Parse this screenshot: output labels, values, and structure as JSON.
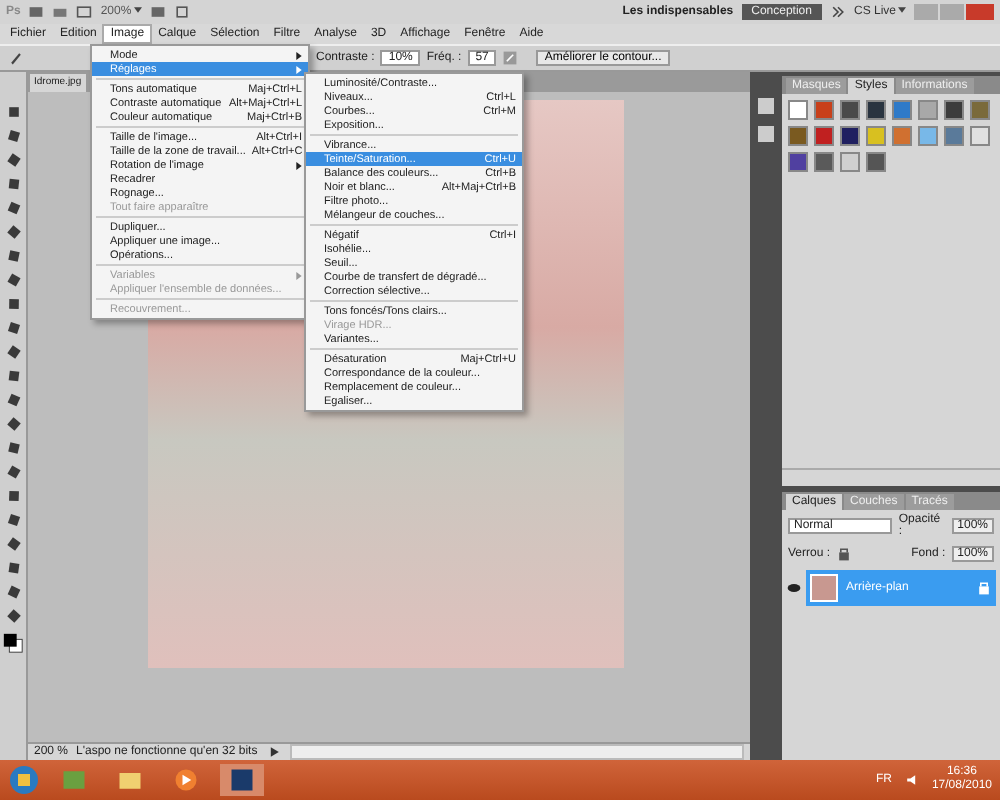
{
  "app_bar": {
    "logo": "Ps",
    "zoom": "200%",
    "workspace": "Les indispensables",
    "workspace_button": "Conception",
    "cs_live": "CS Live"
  },
  "menu_bar": [
    {
      "label": "Fichier",
      "selected": false
    },
    {
      "label": "Edition",
      "selected": false
    },
    {
      "label": "Image",
      "selected": true
    },
    {
      "label": "Calque",
      "selected": false
    },
    {
      "label": "Sélection",
      "selected": false
    },
    {
      "label": "Filtre",
      "selected": false
    },
    {
      "label": "Analyse",
      "selected": false
    },
    {
      "label": "3D",
      "selected": false
    },
    {
      "label": "Affichage",
      "selected": false
    },
    {
      "label": "Fenêtre",
      "selected": false
    },
    {
      "label": "Aide",
      "selected": false
    }
  ],
  "options_bar": {
    "contrast_label": "Contraste :",
    "contrast_value": "10%",
    "freq_label": "Fréq. :",
    "freq_value": "57",
    "refine_button": "Améliorer le contour..."
  },
  "document": {
    "tab": "Idrome.jpg",
    "zoom": "200 %",
    "status": "L'aspo ne fonctionne qu'en 32 bits"
  },
  "image_menu": [
    {
      "kind": "item",
      "label": "Mode",
      "submenu": true,
      "selected": false,
      "disabled": false
    },
    {
      "kind": "item",
      "label": "Réglages",
      "submenu": true,
      "selected": true,
      "disabled": false
    },
    {
      "kind": "separator"
    },
    {
      "kind": "item",
      "label": "Tons automatique",
      "shortcut": "Maj+Ctrl+L",
      "selected": false,
      "disabled": false
    },
    {
      "kind": "item",
      "label": "Contraste automatique",
      "shortcut": "Alt+Maj+Ctrl+L",
      "selected": false,
      "disabled": false
    },
    {
      "kind": "item",
      "label": "Couleur automatique",
      "shortcut": "Maj+Ctrl+B",
      "selected": false,
      "disabled": false
    },
    {
      "kind": "separator"
    },
    {
      "kind": "item",
      "label": "Taille de l'image...",
      "shortcut": "Alt+Ctrl+I",
      "selected": false,
      "disabled": false
    },
    {
      "kind": "item",
      "label": "Taille de la zone de travail...",
      "shortcut": "Alt+Ctrl+C",
      "selected": false,
      "disabled": false
    },
    {
      "kind": "item",
      "label": "Rotation de l'image",
      "submenu": true,
      "selected": false,
      "disabled": false
    },
    {
      "kind": "item",
      "label": "Recadrer",
      "selected": false,
      "disabled": false
    },
    {
      "kind": "item",
      "label": "Rognage...",
      "selected": false,
      "disabled": false
    },
    {
      "kind": "item",
      "label": "Tout faire apparaître",
      "selected": false,
      "disabled": true
    },
    {
      "kind": "separator"
    },
    {
      "kind": "item",
      "label": "Dupliquer...",
      "selected": false,
      "disabled": false
    },
    {
      "kind": "item",
      "label": "Appliquer une image...",
      "selected": false,
      "disabled": false
    },
    {
      "kind": "item",
      "label": "Opérations...",
      "selected": false,
      "disabled": false
    },
    {
      "kind": "separator"
    },
    {
      "kind": "item",
      "label": "Variables",
      "submenu": true,
      "selected": false,
      "disabled": true
    },
    {
      "kind": "item",
      "label": "Appliquer l'ensemble de données...",
      "selected": false,
      "disabled": true
    },
    {
      "kind": "separator"
    },
    {
      "kind": "item",
      "label": "Recouvrement...",
      "selected": false,
      "disabled": true
    }
  ],
  "adjust_menu": [
    {
      "kind": "item",
      "label": "Luminosité/Contraste...",
      "selected": false,
      "disabled": false
    },
    {
      "kind": "item",
      "label": "Niveaux...",
      "shortcut": "Ctrl+L",
      "selected": false,
      "disabled": false
    },
    {
      "kind": "item",
      "label": "Courbes...",
      "shortcut": "Ctrl+M",
      "selected": false,
      "disabled": false
    },
    {
      "kind": "item",
      "label": "Exposition...",
      "selected": false,
      "disabled": false
    },
    {
      "kind": "separator"
    },
    {
      "kind": "item",
      "label": "Vibrance...",
      "selected": false,
      "disabled": false
    },
    {
      "kind": "item",
      "label": "Teinte/Saturation...",
      "shortcut": "Ctrl+U",
      "selected": true,
      "disabled": false
    },
    {
      "kind": "item",
      "label": "Balance des couleurs...",
      "shortcut": "Ctrl+B",
      "selected": false,
      "disabled": false
    },
    {
      "kind": "item",
      "label": "Noir et blanc...",
      "shortcut": "Alt+Maj+Ctrl+B",
      "selected": false,
      "disabled": false
    },
    {
      "kind": "item",
      "label": "Filtre photo...",
      "selected": false,
      "disabled": false
    },
    {
      "kind": "item",
      "label": "Mélangeur de couches...",
      "selected": false,
      "disabled": false
    },
    {
      "kind": "separator"
    },
    {
      "kind": "item",
      "label": "Négatif",
      "shortcut": "Ctrl+I",
      "selected": false,
      "disabled": false
    },
    {
      "kind": "item",
      "label": "Isohélie...",
      "selected": false,
      "disabled": false
    },
    {
      "kind": "item",
      "label": "Seuil...",
      "selected": false,
      "disabled": false
    },
    {
      "kind": "item",
      "label": "Courbe de transfert de dégradé...",
      "selected": false,
      "disabled": false
    },
    {
      "kind": "item",
      "label": "Correction sélective...",
      "selected": false,
      "disabled": false
    },
    {
      "kind": "separator"
    },
    {
      "kind": "item",
      "label": "Tons foncés/Tons clairs...",
      "selected": false,
      "disabled": false
    },
    {
      "kind": "item",
      "label": "Virage HDR...",
      "selected": false,
      "disabled": true
    },
    {
      "kind": "item",
      "label": "Variantes...",
      "selected": false,
      "disabled": false
    },
    {
      "kind": "separator"
    },
    {
      "kind": "item",
      "label": "Désaturation",
      "shortcut": "Maj+Ctrl+U",
      "selected": false,
      "disabled": false
    },
    {
      "kind": "item",
      "label": "Correspondance de la couleur...",
      "selected": false,
      "disabled": false
    },
    {
      "kind": "item",
      "label": "Remplacement de couleur...",
      "selected": false,
      "disabled": false
    },
    {
      "kind": "item",
      "label": "Egaliser...",
      "selected": false,
      "disabled": false
    }
  ],
  "styles_panel": {
    "tabs": [
      {
        "label": "Masques",
        "selected": false
      },
      {
        "label": "Styles",
        "selected": true
      },
      {
        "label": "Informations",
        "selected": false
      }
    ],
    "swatches": [
      {
        "color": "#ffffff"
      },
      {
        "color": "#c8401a"
      },
      {
        "color": "#4a4a4a"
      },
      {
        "color": "#2a3440"
      },
      {
        "color": "#2f7ac8"
      },
      {
        "color": "#a8a8a8"
      },
      {
        "color": "#3c3c3c"
      },
      {
        "color": "#7a6a3a"
      },
      {
        "color": "#7a5a20"
      },
      {
        "color": "#c02020"
      },
      {
        "color": "#202060"
      },
      {
        "color": "#d8c020"
      },
      {
        "color": "#d07030"
      },
      {
        "color": "#78b8e8"
      },
      {
        "color": "#5a7a9a"
      },
      {
        "color": "#e0e0e0"
      },
      {
        "color": "#5040a0"
      },
      {
        "color": "#5a5a5a"
      },
      {
        "color": "#cfcfcf"
      },
      {
        "color": "#555555"
      }
    ]
  },
  "layers_panel": {
    "tabs": [
      {
        "label": "Calques",
        "selected": true
      },
      {
        "label": "Couches",
        "selected": false
      },
      {
        "label": "Tracés",
        "selected": false
      }
    ],
    "blend_mode": "Normal",
    "opacity_label": "Opacité :",
    "opacity": "100%",
    "lock_label": "Verrou :",
    "fill_label": "Fond :",
    "fill": "100%",
    "layers": [
      {
        "name": "Arrière-plan",
        "selected": true,
        "visible": true,
        "locked": true
      }
    ]
  },
  "taskbar": {
    "language": "FR",
    "time": "16:36",
    "date": "17/08/2010"
  }
}
